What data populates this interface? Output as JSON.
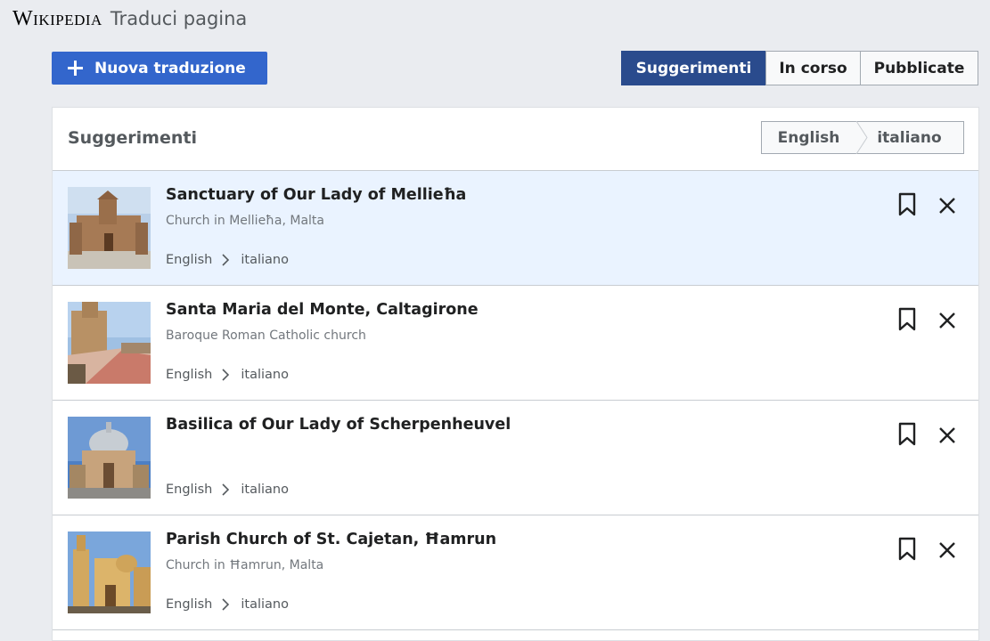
{
  "header": {
    "wordmark": "Wikipedia",
    "title": "Traduci pagina"
  },
  "actions": {
    "new_translation_label": "Nuova traduzione"
  },
  "filters": [
    {
      "label": "Suggerimenti",
      "active": true
    },
    {
      "label": "In corso",
      "active": false
    },
    {
      "label": "Pubblicate",
      "active": false
    }
  ],
  "panel": {
    "title": "Suggerimenti",
    "source_language": "English",
    "target_language": "italiano"
  },
  "suggestions": [
    {
      "title": "Sanctuary of Our Lady of Mellieħa",
      "description": "Church in Mellieħa, Malta",
      "source_language": "English",
      "target_language": "italiano"
    },
    {
      "title": "Santa Maria del Monte, Caltagirone",
      "description": "Baroque Roman Catholic church",
      "source_language": "English",
      "target_language": "italiano"
    },
    {
      "title": "Basilica of Our Lady of Scherpenheuvel",
      "description": "",
      "source_language": "English",
      "target_language": "italiano"
    },
    {
      "title": "Parish Church of St. Cajetan, Ħamrun",
      "description": "Church in Ħamrun, Malta",
      "source_language": "English",
      "target_language": "italiano"
    }
  ],
  "colors": {
    "primary": "#3366cc",
    "active_filter": "#2a4b8d",
    "highlight_row": "#eaf3ff",
    "page_background": "#eaecf0"
  }
}
